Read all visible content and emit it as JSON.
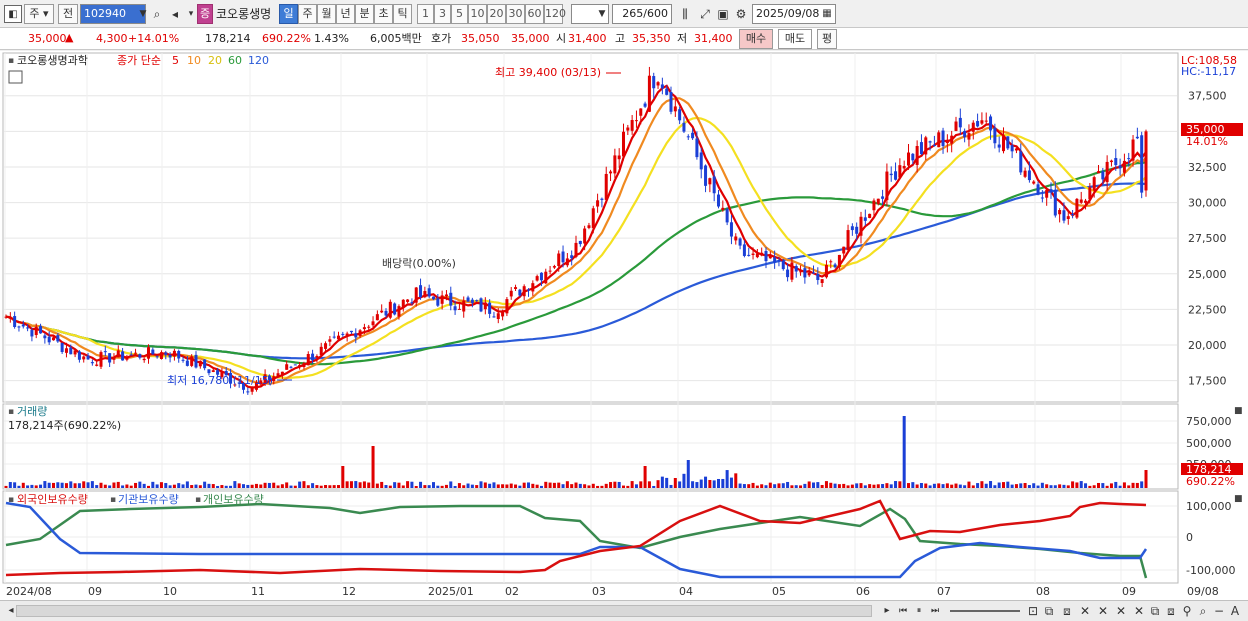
{
  "toolbar": {
    "period_label": "주",
    "prev_label": "전",
    "code": "102940",
    "stock_badge": "증",
    "stock_name": "코오롱생명",
    "period_tabs": [
      "일",
      "주",
      "월",
      "년",
      "분",
      "초",
      "틱"
    ],
    "active_tab": "일",
    "intervals": [
      "1",
      "3",
      "5",
      "10",
      "20",
      "30",
      "60",
      "120"
    ],
    "count_value": "265",
    "count_total": "/600",
    "date": "2025/09/08"
  },
  "quote": {
    "price": "35,000",
    "change": "4,300",
    "change_pct": "+14.01%",
    "volume": "178,214",
    "volume_ratio": "690.22%",
    "turnover": "1.43%",
    "amount": "6,005백만",
    "bid_label": "호가",
    "bid": "35,050",
    "ask": "35,000",
    "open_label": "시",
    "open": "31,400",
    "high_label": "고",
    "high": "35,350",
    "low_label": "저",
    "low": "31,400",
    "buy_label": "매수",
    "sell_label": "매도",
    "eval_label": "평"
  },
  "price_panel": {
    "title": "코오롱생명과학",
    "ma_label": "종가 단순",
    "ma_periods": [
      "5",
      "10",
      "20",
      "60",
      "120"
    ],
    "lc": "LC:108,58",
    "hc": "HC:-11,17",
    "high_annotation": "최고 39,400 (03/13)",
    "low_annotation": "최저 16,780 (11/15)",
    "dividend_annotation": "배당락(0.00%)",
    "current_price_tag": "35,000",
    "current_pct_tag": "14.01%",
    "y_ticks": [
      "37,500",
      "35,000",
      "32,500",
      "30,000",
      "27,500",
      "25,000",
      "22,500",
      "20,000",
      "17,500"
    ]
  },
  "volume_panel": {
    "title": "거래량",
    "value": "178,214주(690.22%)",
    "y_ticks": [
      "750,000",
      "500,000",
      "250,000"
    ],
    "tag_value": "178,214",
    "tag_pct": "690.22%"
  },
  "holding_panel": {
    "legend": [
      "외국인보유수량",
      "기관보유수량",
      "개인보유수량"
    ],
    "y_ticks": [
      "100,000",
      "0",
      "-100,000"
    ]
  },
  "x_axis": [
    "2024/08",
    "09",
    "10",
    "11",
    "12",
    "2025/01",
    "02",
    "03",
    "04",
    "05",
    "06",
    "07",
    "08",
    "09",
    "09/08"
  ],
  "colors": {
    "up": "#e00000",
    "down": "#1a3fd6",
    "ma5": "#e00000",
    "ma10": "#f08a20",
    "ma20": "#f4e020",
    "ma60": "#2a9a3a",
    "ma120": "#2a5ad8",
    "foreign": "#d81010",
    "institution": "#2a5ad8",
    "individual": "#3a8a50"
  },
  "chart_data": {
    "type": "candlestick",
    "title": "코오롱생명과학",
    "y_range_price": [
      16000,
      40000
    ],
    "price_path": [
      [
        "2024/08",
        22000
      ],
      [
        "09",
        19000
      ],
      [
        "10",
        19500
      ],
      [
        "11",
        17000
      ],
      [
        "12",
        20000
      ],
      [
        "2025/01",
        23500
      ],
      [
        "02",
        22500
      ],
      [
        "02b",
        27000
      ],
      [
        "03",
        39400
      ],
      [
        "04",
        26500
      ],
      [
        "05",
        24500
      ],
      [
        "06",
        33000
      ],
      [
        "07",
        36000
      ],
      [
        "08",
        29000
      ],
      [
        "09",
        35000
      ]
    ],
    "series": [
      {
        "name": "5",
        "role": "ma"
      },
      {
        "name": "10",
        "role": "ma"
      },
      {
        "name": "20",
        "role": "ma"
      },
      {
        "name": "60",
        "role": "ma"
      },
      {
        "name": "120",
        "role": "ma"
      }
    ]
  }
}
